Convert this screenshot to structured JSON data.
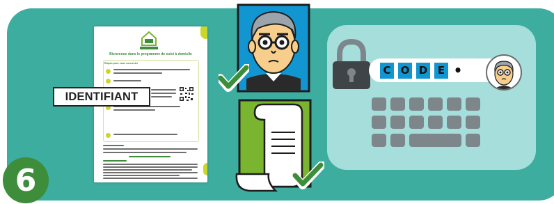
{
  "step": {
    "number": "6"
  },
  "document": {
    "title": "Bienvenue dans le programme de suivi à domicile",
    "box_heading": "Étapes pour vous connecter"
  },
  "identifier": {
    "label": "IDENTIFIANT"
  },
  "lock_screen": {
    "code_letters": [
      "C",
      "O",
      "D",
      "E"
    ],
    "code_suffix": "•"
  },
  "icons": {
    "portrait": "portrait-card-icon",
    "scroll": "scroll-document-icon",
    "checkmark": "checkmark-icon",
    "padlock": "padlock-icon",
    "keyboard": "keyboard-icon",
    "avatar": "user-avatar-icon"
  },
  "colors": {
    "panel": "#3dada0",
    "badge": "#3e8d3a",
    "lock_screen": "#a6dedc",
    "code_keys": "#1296d2",
    "portrait_bg": "#1296d2",
    "scroll_bg": "#7ab52f",
    "accent_lime": "#c9d62b"
  }
}
